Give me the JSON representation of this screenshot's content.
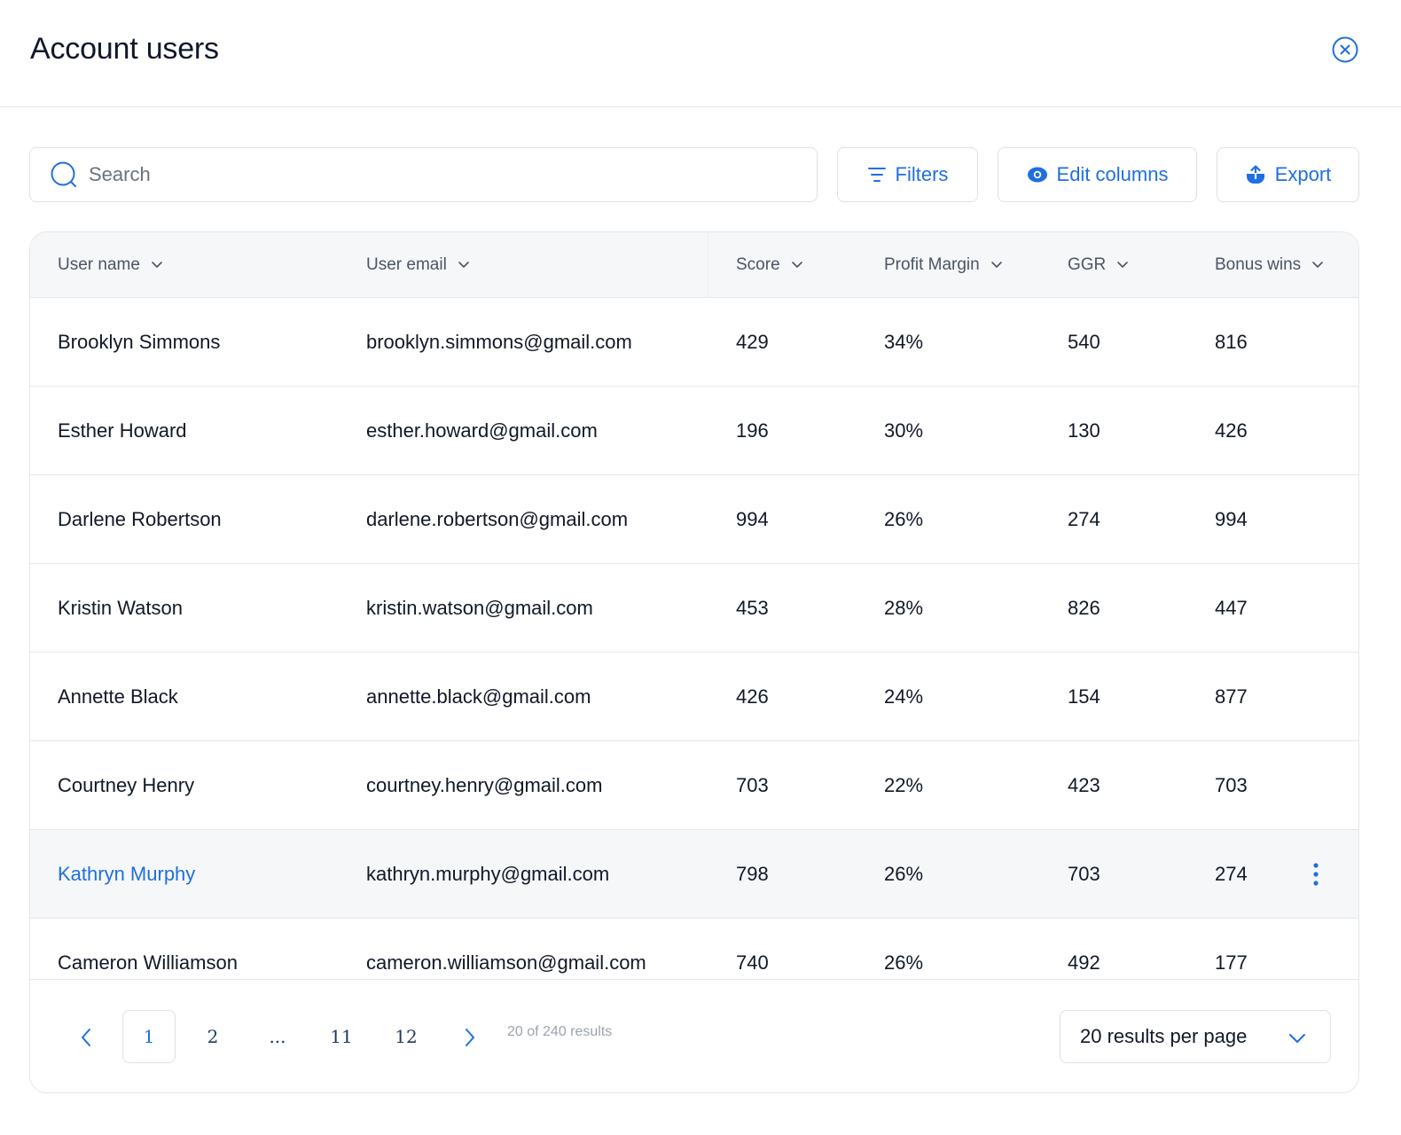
{
  "header": {
    "title": "Account users",
    "close_icon": "close-circle-icon"
  },
  "toolbar": {
    "search_placeholder": "Search",
    "search_value": "",
    "filters_label": "Filters",
    "edit_columns_label": "Edit columns",
    "export_label": "Export"
  },
  "table": {
    "columns": [
      "User name",
      "User email",
      "Score",
      "Profit Margin",
      "GGR",
      "Bonus wins"
    ],
    "rows": [
      {
        "name": "Brooklyn Simmons",
        "email": "brooklyn.simmons@gmail.com",
        "score": "429",
        "margin": "34%",
        "ggr": "540",
        "bonus": "816"
      },
      {
        "name": "Esther Howard",
        "email": "esther.howard@gmail.com",
        "score": "196",
        "margin": "30%",
        "ggr": "130",
        "bonus": "426"
      },
      {
        "name": "Darlene Robertson",
        "email": "darlene.robertson@gmail.com",
        "score": "994",
        "margin": "26%",
        "ggr": "274",
        "bonus": "994"
      },
      {
        "name": "Kristin Watson",
        "email": "kristin.watson@gmail.com",
        "score": "453",
        "margin": "28%",
        "ggr": "826",
        "bonus": "447"
      },
      {
        "name": "Annette Black",
        "email": "annette.black@gmail.com",
        "score": "426",
        "margin": "24%",
        "ggr": "154",
        "bonus": "877"
      },
      {
        "name": "Courtney Henry",
        "email": "courtney.henry@gmail.com",
        "score": "703",
        "margin": "22%",
        "ggr": "423",
        "bonus": "703"
      },
      {
        "name": "Kathryn Murphy",
        "email": "kathryn.murphy@gmail.com",
        "score": "798",
        "margin": "26%",
        "ggr": "703",
        "bonus": "274"
      },
      {
        "name": "Cameron Williamson",
        "email": "cameron.williamson@gmail.com",
        "score": "740",
        "margin": "26%",
        "ggr": "492",
        "bonus": "177"
      }
    ],
    "highlighted_row": 6
  },
  "pagination": {
    "pages": [
      "1",
      "2",
      "...",
      "11",
      "12"
    ],
    "current_page": "1",
    "results_text": "20 of 240 results",
    "per_page_label": "20 results per page"
  },
  "colors": {
    "accent": "#1f6fe0",
    "header_bg": "#f6f7f9",
    "border": "#e5e7eb"
  }
}
